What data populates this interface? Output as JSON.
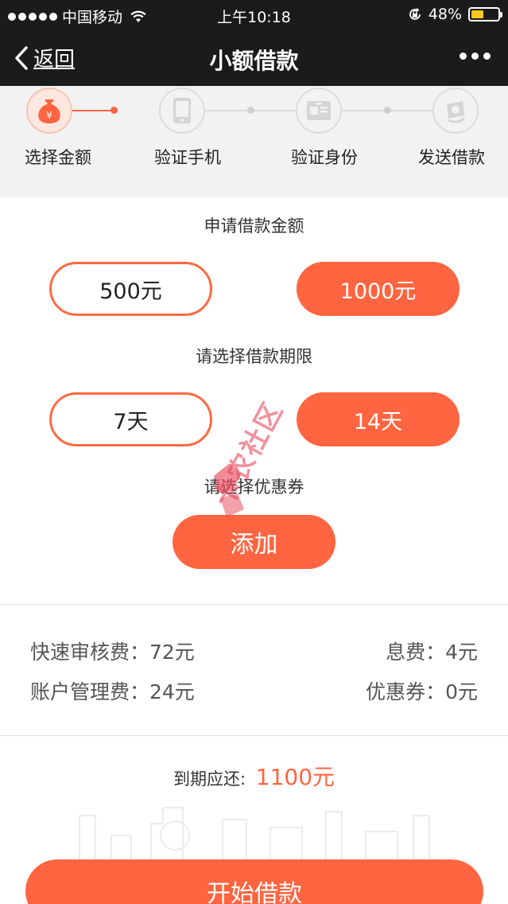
{
  "status_bar": {
    "carrier": "中国移动",
    "time": "上午10:18",
    "battery": "48%",
    "battery_level": 0.48
  },
  "nav": {
    "back_label": "返回",
    "title": "小额借款"
  },
  "steps": [
    {
      "label": "选择金额",
      "icon": "money-bag-icon",
      "active": true
    },
    {
      "label": "验证手机",
      "icon": "phone-icon",
      "active": false
    },
    {
      "label": "验证身份",
      "icon": "id-card-icon",
      "active": false
    },
    {
      "label": "发送借款",
      "icon": "send-money-icon",
      "active": false
    }
  ],
  "amount": {
    "title": "申请借款金额",
    "options": [
      "500元",
      "1000元"
    ],
    "selected": "1000元"
  },
  "term": {
    "title": "请选择借款期限",
    "options": [
      "7天",
      "14天"
    ],
    "selected": "14天"
  },
  "coupon": {
    "title": "请选择优惠券",
    "add_label": "添加"
  },
  "fees": {
    "review_fee": "快速审核费：72元",
    "interest_fee": "息费：4元",
    "account_fee": "账户管理费：24元",
    "coupon_value": "优惠券：0元"
  },
  "due": {
    "label": "到期应还:",
    "amount": "1100元"
  },
  "watermark_text": "卡农社区",
  "start_button": "开始借款",
  "colors": {
    "accent": "#ff6540",
    "header_bg": "#1b1b1b",
    "steps_bg": "#f2f2f2"
  }
}
